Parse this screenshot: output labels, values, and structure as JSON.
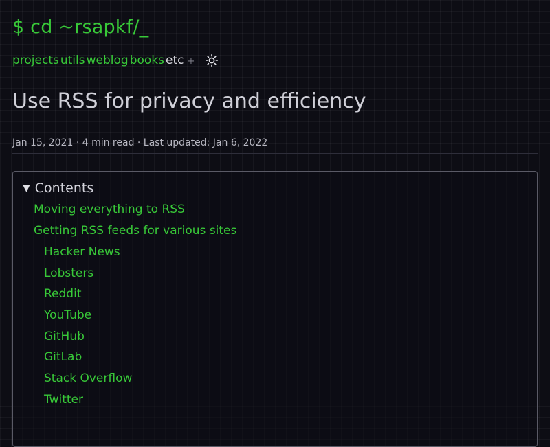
{
  "header": {
    "logo": "$ cd ~rsapkf/_",
    "nav": [
      "projects",
      "utils",
      "weblog",
      "books"
    ],
    "etc": "etc",
    "plus": "+"
  },
  "post": {
    "title": "Use RSS for privacy and efficiency",
    "meta": "Jan 15, 2021 · 4 min read · Last updated: Jan 6, 2022"
  },
  "toc": {
    "heading": "Contents",
    "items": [
      "Moving everything to RSS",
      "Getting RSS feeds for various sites",
      "Hacker News",
      "Lobsters",
      "Reddit",
      "YouTube",
      "GitHub",
      "GitLab",
      "Stack Overflow",
      "Twitter"
    ]
  },
  "icons": {
    "theme": "sun-icon",
    "toggle": "triangle-down-icon"
  },
  "colors": {
    "accent": "#38c838",
    "background": "#0d0d14",
    "text": "#c9c9d1"
  }
}
